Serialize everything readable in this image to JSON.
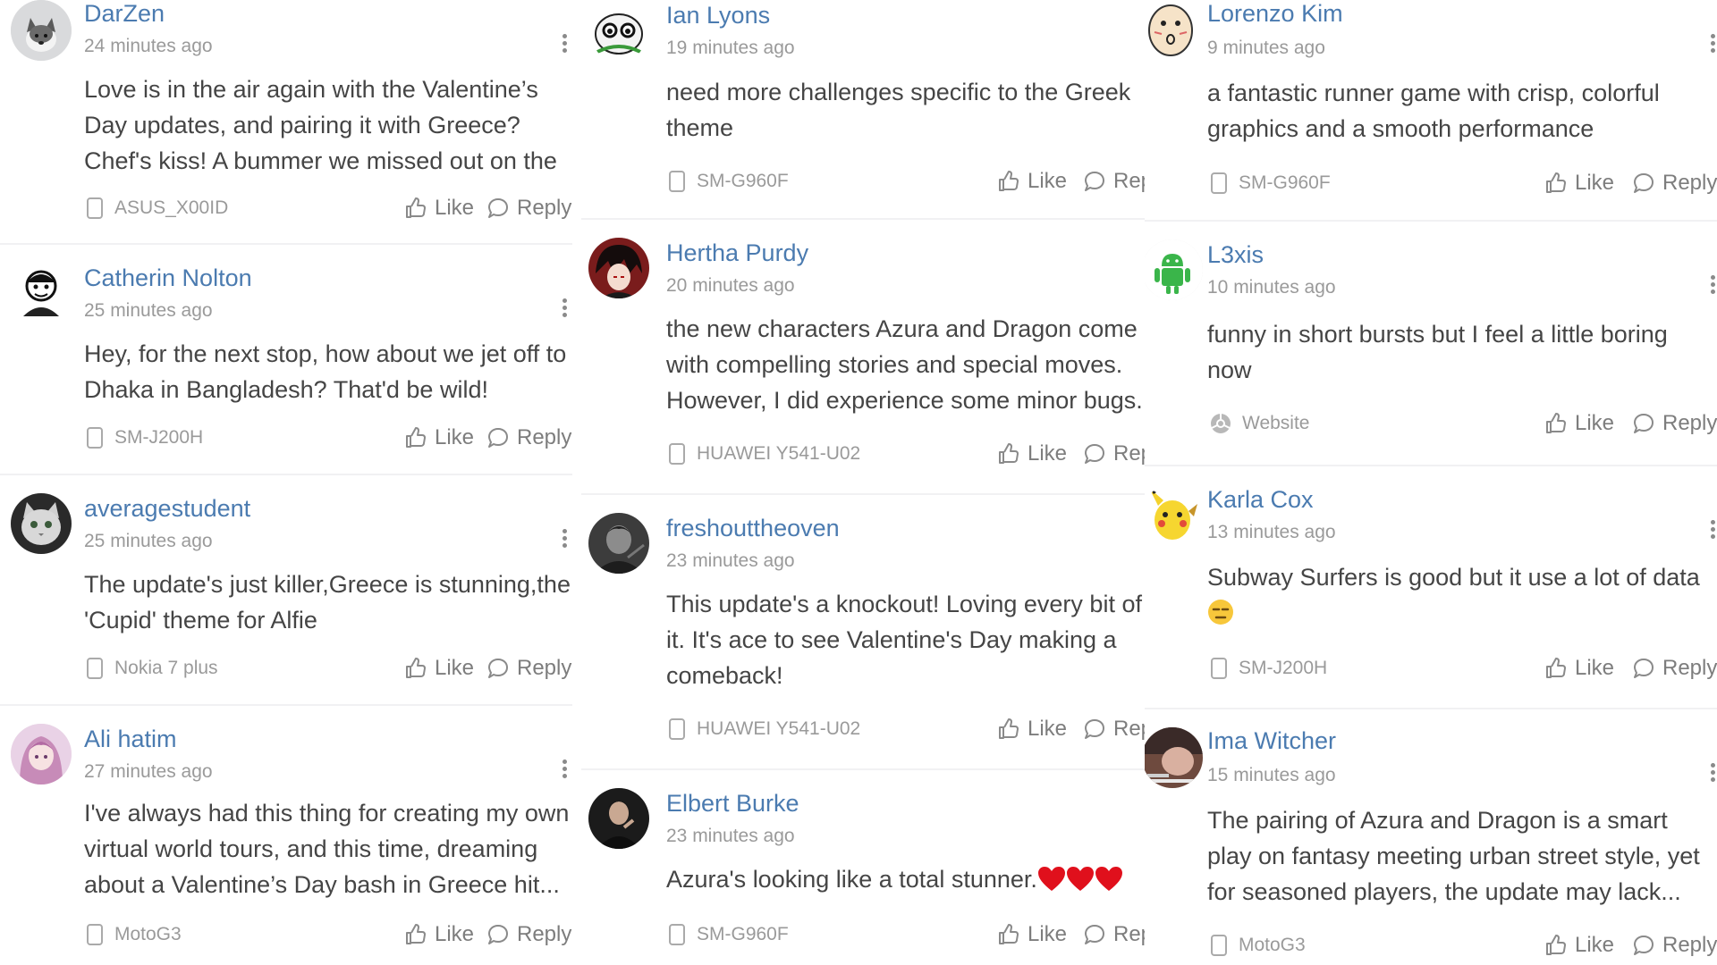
{
  "columns": [
    {
      "comments": [
        {
          "user": "DarZen",
          "time": "24 minutes ago",
          "text": "Love is in the air again with the Valentine’s Day updates, and pairing it with Greece? Chef's kiss! A bummer we missed out on the Lunar...",
          "device": "ASUS_X00ID",
          "like": "Like",
          "reply": "Reply",
          "avatar": "husky-avatar"
        },
        {
          "user": "Catherin Nolton",
          "time": "25 minutes ago",
          "text": "Hey, for the next stop, how about we jet off to Dhaka in Bangladesh? That'd be wild!",
          "device": "SM-J200H",
          "like": "Like",
          "reply": "Reply",
          "avatar": "cartoon-avatar"
        },
        {
          "user": "averagestudent",
          "time": "25 minutes ago",
          "text": "The update's just killer,Greece is stunning,the 'Cupid' theme for Alfie",
          "device": "Nokia 7 plus",
          "like": "Like",
          "reply": "Reply",
          "avatar": "cat-avatar"
        },
        {
          "user": "Ali hatim",
          "time": "27 minutes ago",
          "text": "I've always had this thing for creating my own virtual world tours, and this time, dreaming about a Valentine’s Day bash in Greece hit...",
          "device": "MotoG3",
          "like": "Like",
          "reply": "Reply",
          "avatar": "anime-girl-avatar"
        }
      ]
    },
    {
      "comments": [
        {
          "user": "Ian Lyons",
          "time": "19 minutes ago",
          "text": "need more challenges specific to the Greek theme",
          "device": "SM-G960F",
          "like": "Like",
          "reply": "Reply",
          "avatar": "meme-avatar"
        },
        {
          "user": "Hertha Purdy",
          "time": "20 minutes ago",
          "text": "the new characters Azura and Dragon come with compelling stories and special moves. However, I did experience some minor bugs.",
          "device": "HUAWEI Y541-U02",
          "like": "Like",
          "reply": "Reply",
          "avatar": "anime-boy-avatar"
        },
        {
          "user": "freshouttheoven",
          "time": "23 minutes ago",
          "text": "This update's a knockout! Loving every bit of it. It's ace to see Valentine's Day making a comeback!",
          "device": "HUAWEI Y541-U02",
          "like": "Like",
          "reply": "Reply",
          "avatar": "dark-photo-avatar"
        },
        {
          "user": "Elbert Burke",
          "time": "23 minutes ago",
          "text": "Azura's looking like a total stunner.",
          "device": "SM-G960F",
          "like": "Like",
          "reply": "Reply",
          "avatar": "portrait-avatar",
          "hearts": 3
        }
      ]
    },
    {
      "comments": [
        {
          "user": "Lorenzo Kim",
          "time": "9 minutes ago",
          "text": "a fantastic runner game with crisp, colorful graphics and a smooth performance",
          "device": "SM-G960F",
          "like": "Like",
          "reply": "Reply",
          "avatar": "sketch-face-avatar"
        },
        {
          "user": "L3xis",
          "time": "10 minutes ago",
          "text": "funny in short bursts but I feel a little boring now",
          "device": "Website",
          "like": "Like",
          "reply": "Reply",
          "avatar": "android-avatar",
          "device_icon": "globe-icon"
        },
        {
          "user": "Karla Cox",
          "time": "13 minutes ago",
          "text": "Subway Surfers is good but it use a lot of data",
          "device": "SM-J200H",
          "like": "Like",
          "reply": "Reply",
          "avatar": "pikachu-avatar",
          "trailing_emoji": "😑"
        },
        {
          "user": "Ima Witcher",
          "time": "15 minutes ago",
          "text": "The pairing of Azura and Dragon is a smart play on fantasy meeting urban street style, yet for seasoned players, the update may lack...",
          "device": "MotoG3",
          "like": "Like",
          "reply": "Reply",
          "avatar": "photo-avatar"
        }
      ]
    }
  ],
  "colors": {
    "username": "#4b7bb0",
    "meta": "#9a9a9a",
    "body": "#454545",
    "action": "#7d7d7d",
    "divider": "#f1f1f3",
    "heart": "#e0101c"
  }
}
